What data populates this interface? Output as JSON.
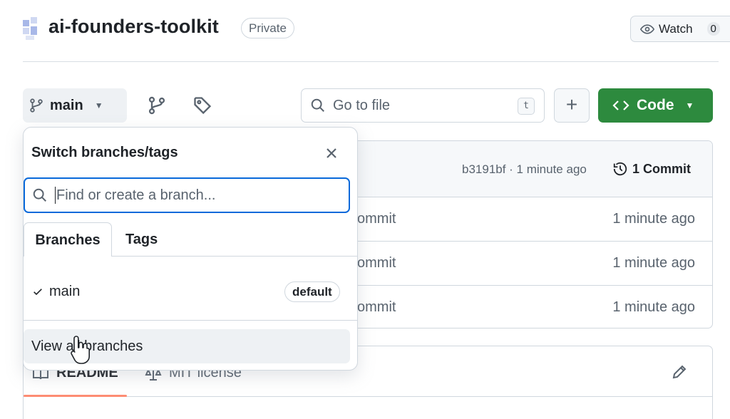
{
  "header": {
    "repo_name": "ai-founders-toolkit",
    "visibility_badge": "Private",
    "watch_label": "Watch",
    "watch_count": "0"
  },
  "toolbar": {
    "branch_name": "main",
    "goto_placeholder": "Go to file",
    "goto_shortcut": "t",
    "add_label": "+",
    "code_label": "Code"
  },
  "commit_bar": {
    "meta": "b3191bf · 1 minute ago",
    "commit_count": "1 Commit"
  },
  "file_rows": [
    {
      "message": "ommit",
      "time": "1 minute ago"
    },
    {
      "message": "ommit",
      "time": "1 minute ago"
    },
    {
      "message": "ommit",
      "time": "1 minute ago"
    }
  ],
  "readme": {
    "readme_tab": "README",
    "license_tab": "MIT license"
  },
  "dropdown": {
    "title": "Switch branches/tags",
    "input_placeholder": "Find or create a branch...",
    "tabs": [
      {
        "label": "Branches",
        "active": true
      },
      {
        "label": "Tags",
        "active": false
      }
    ],
    "branches": [
      {
        "name": "main",
        "badge": "default",
        "selected": true
      }
    ],
    "view_all_label": "View all branches"
  },
  "colors": {
    "code_button": "#2d8a3e",
    "focus_ring": "#0969da",
    "tab_underline": "#fd8c73"
  },
  "icons": {
    "branch": "git-branch-icon",
    "tag": "tag-icon",
    "search": "search-icon",
    "close": "close-icon",
    "check": "check-icon",
    "history": "history-icon",
    "eye": "eye-icon",
    "code": "code-icon",
    "book": "book-icon",
    "law": "law-icon",
    "pencil": "pencil-icon"
  }
}
